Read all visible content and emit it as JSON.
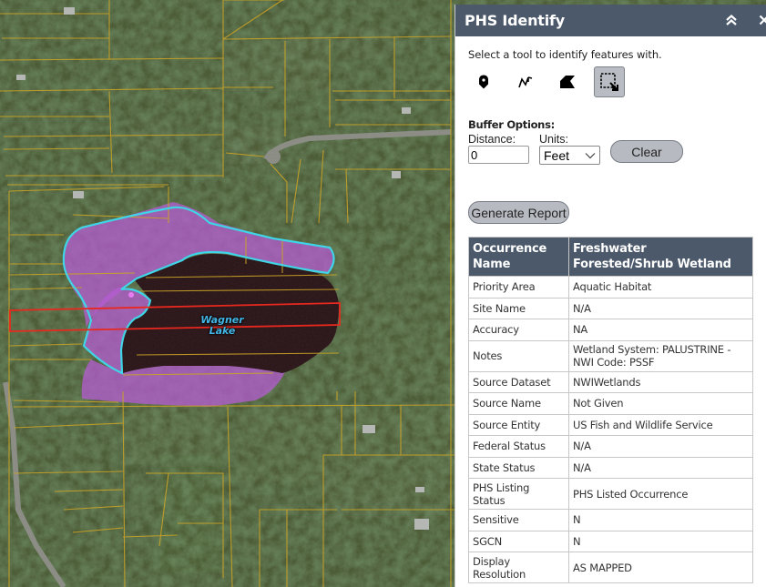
{
  "map": {
    "lake_label": "Wagner\nLake",
    "colors": {
      "parcel_line": "#c9a227",
      "wetland_fill": "#b45ad2",
      "wetland_outline": "#3fd5e6",
      "selection_box": "#e8281e",
      "lake_water": "#2a1518"
    }
  },
  "panel": {
    "title": "PHS Identify",
    "header_icons": [
      "collapse-icon",
      "close-icon"
    ],
    "instruction": "Select a tool to identify features with.",
    "tools": [
      {
        "name": "point-tool",
        "icon": "map-pin-icon",
        "active": false
      },
      {
        "name": "polyline-tool",
        "icon": "polyline-icon",
        "active": false
      },
      {
        "name": "polygon-tool",
        "icon": "polygon-icon",
        "active": false
      },
      {
        "name": "rectangle-tool",
        "icon": "rectangle-select-icon",
        "active": true
      }
    ],
    "buffer": {
      "title": "Buffer Options:",
      "distance_label": "Distance:",
      "distance_value": "0",
      "units_label": "Units:",
      "units_value": "Feet",
      "clear_label": "Clear"
    },
    "generate_report_label": "Generate Report",
    "table": {
      "header": [
        "Occurrence Name",
        "Freshwater Forested/Shrub Wetland"
      ],
      "rows": [
        [
          "Priority Area",
          "Aquatic Habitat"
        ],
        [
          "Site Name",
          "N/A"
        ],
        [
          "Accuracy",
          "NA"
        ],
        [
          "Notes",
          "Wetland System: PALUSTRINE - NWI Code: PSSF"
        ],
        [
          "Source Dataset",
          "NWIWetlands"
        ],
        [
          "Source Name",
          "Not Given"
        ],
        [
          "Source Entity",
          "US Fish and Wildlife Service"
        ],
        [
          "Federal Status",
          "N/A"
        ],
        [
          "State Status",
          "N/A"
        ],
        [
          "PHS Listing Status",
          "PHS Listed Occurrence"
        ],
        [
          "Sensitive",
          "N"
        ],
        [
          "SGCN",
          "N"
        ],
        [
          "Display Resolution",
          "AS MAPPED"
        ]
      ]
    }
  }
}
